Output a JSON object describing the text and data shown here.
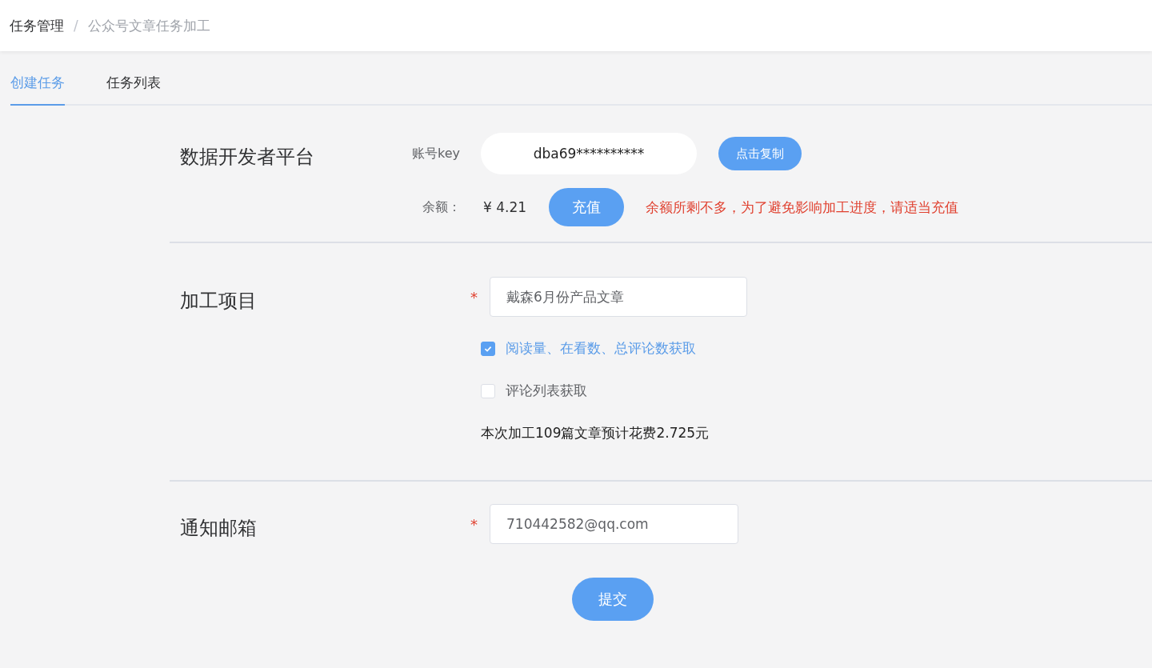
{
  "breadcrumb": {
    "items": [
      {
        "label": "任务管理",
        "current": false
      },
      {
        "label": "公众号文章任务加工",
        "current": true
      }
    ],
    "separator": "/"
  },
  "tabs": [
    {
      "label": "创建任务",
      "selected": true
    },
    {
      "label": "任务列表",
      "selected": false
    }
  ],
  "developer_platform": {
    "title": "数据开发者平台",
    "key_label": "账号key",
    "key_value": "dba69**********",
    "copy_button": "点击复制",
    "balance_label": "余额：",
    "balance": "¥ 4.21",
    "recharge_button": "充值",
    "warning": "余额所剩不多，为了避免影响加工进度，请适当充值"
  },
  "processing": {
    "title": "加工项目",
    "required_mark": "*",
    "name_value": "戴森6月份产品文章",
    "options": [
      {
        "label": "阅读量、在看数、总评论数获取",
        "checked": true
      },
      {
        "label": "评论列表获取",
        "checked": false
      }
    ],
    "estimate": "本次加工109篇文章预计花费2.725元"
  },
  "notification": {
    "title": "通知邮箱",
    "required_mark": "*",
    "email_value": "710442582@qq.com"
  },
  "submit_button": "提交"
}
